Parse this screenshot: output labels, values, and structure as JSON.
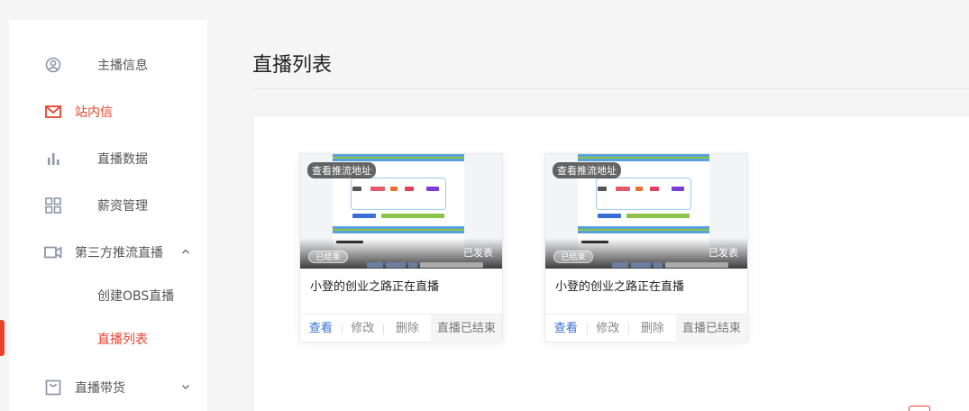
{
  "sidebar": {
    "items": [
      {
        "label": "主播信息",
        "icon": "user-circle-icon"
      },
      {
        "label": "站内信",
        "icon": "mail-icon"
      },
      {
        "label": "直播数据",
        "icon": "bar-chart-icon"
      },
      {
        "label": "薪资管理",
        "icon": "grid-icon"
      },
      {
        "label": "第三方推流直播",
        "icon": "video-camera-icon"
      },
      {
        "label": "创建OBS直播"
      },
      {
        "label": "直播列表"
      },
      {
        "label": "直播带货",
        "icon": "shopping-bag-icon"
      }
    ]
  },
  "page": {
    "title": "直播列表"
  },
  "cards": [
    {
      "thumb_tag": "查看推流地址",
      "ended_tag": "已结束",
      "published_tag": "已发表",
      "title": "小登的创业之路正在直播",
      "actions": {
        "view": "查看",
        "edit": "修改",
        "delete": "删除",
        "status": "直播已结束"
      }
    },
    {
      "thumb_tag": "查看推流地址",
      "ended_tag": "已结束",
      "published_tag": "已发表",
      "title": "小登的创业之路正在直播",
      "actions": {
        "view": "查看",
        "edit": "修改",
        "delete": "删除",
        "status": "直播已结束"
      }
    }
  ],
  "colors": {
    "accent": "#e8412c",
    "link": "#3a6fd8",
    "icon": "#8c97a8"
  }
}
